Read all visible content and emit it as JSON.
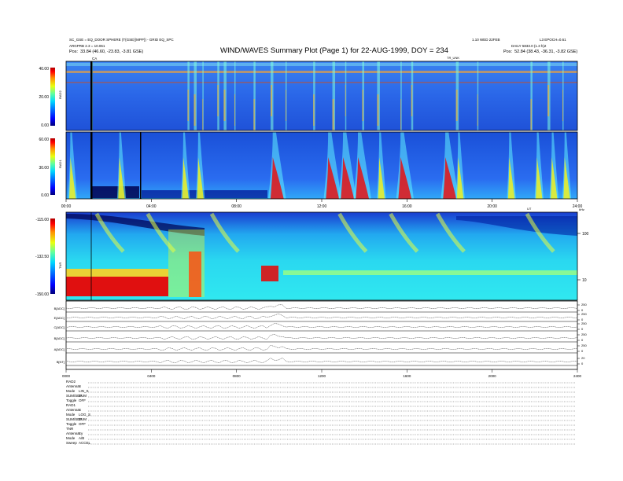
{
  "header": {
    "title": "WIND/WAVES Summary Plot (Page 1) for 22-AUG-1999, DOY = 234",
    "left_line1": "SC_GSE = EQ_DOOR SPHERE (T{GSE}{MPP}) - GRID EQ_SPC",
    "left_line2": "ARGPRB 2.3 = 10.061",
    "left_pos_label": "Pos:",
    "left_pos_value": "33.84 (46.60, -23.83, -3.81 GSE)",
    "right_line1": "1.10 WED 22FEB",
    "right_line1b": "L3 EPOCH=0.61",
    "right_line2": "DAILY 5833.0 (1.3 h)2",
    "right_pos_label": "Pos:",
    "right_pos_value": "52.84 (38.43, -36.31, -3.82 GSE)",
    "ca_marker": "CA",
    "tr_label": "TR_UNK"
  },
  "colors": {
    "colorbar": [
      "#00007a",
      "#0000ff",
      "#0070ff",
      "#00d8ff",
      "#60ffa0",
      "#e8ff10",
      "#ff9000",
      "#ff0000",
      "#b00000"
    ],
    "background_blue": "#2a66e8",
    "burst_red": "#e01010",
    "axis": "#000000"
  },
  "chart_data": [
    {
      "type": "heatmap",
      "name": "RAD2",
      "ylabel": "RAD2",
      "colorbar_ticks": [
        "40.00",
        "20.00",
        "0.00"
      ],
      "zlim": [
        0,
        40
      ],
      "xlim_hours": [
        0,
        24
      ],
      "bursts_hours": [
        1.2,
        5.7,
        6.0,
        6.4,
        7.1,
        7.4,
        7.9,
        8.8,
        9.6,
        10.3,
        11.6,
        12.5,
        13.1,
        13.9,
        14.6,
        15.7,
        16.2,
        18.3,
        19.3,
        21.8,
        22.6,
        23.3
      ]
    },
    {
      "type": "heatmap",
      "name": "RAD1",
      "ylabel": "RAD1",
      "colorbar_ticks": [
        "60.00",
        "30.00",
        "0.00"
      ],
      "zlim": [
        0,
        60
      ],
      "xlim_hours": [
        0,
        24
      ],
      "x_ticks": [
        "00:00",
        "04:00",
        "08:00",
        "12:00",
        "16:00",
        "20:00",
        "24:00"
      ],
      "x_axis_unit": "UT",
      "bursts_hours": [
        0.2,
        2.5,
        5.5,
        6.2,
        9.7,
        12.3,
        13.0,
        13.7,
        14.7,
        15.7,
        17.8,
        18.4,
        20.8,
        22.1,
        22.8,
        23.4
      ]
    },
    {
      "type": "heatmap",
      "name": "TNR",
      "ylabel": "TNR",
      "colorbar_ticks": [
        "-115.00",
        "-132.50",
        "-150.00"
      ],
      "zlim": [
        -150,
        -115
      ],
      "right_axis_ticks": [
        "100",
        "10"
      ],
      "right_axis_unit": "kHz",
      "xlim_hours": [
        0,
        24
      ]
    },
    {
      "type": "line",
      "name": "housekeeping",
      "series": [
        {
          "name": "B[ADC]"
        },
        {
          "name": "E[ADC]"
        },
        {
          "name": "C[ADC]"
        },
        {
          "name": "B[ADC]"
        },
        {
          "name": "A[ADC]"
        },
        {
          "name": "B[NT]"
        }
      ],
      "right_ticks": [
        "250",
        "0",
        "250",
        "0",
        "250",
        "0",
        "250",
        "0",
        "250",
        "0",
        "20",
        "0"
      ],
      "x_ticks": [
        "0000",
        "0400",
        "0800",
        "1200",
        "1600",
        "2000",
        "2400"
      ],
      "xlim_hours": [
        0,
        24
      ]
    }
  ],
  "status_table": {
    "rows": [
      {
        "key": "RAD2",
        "value": ""
      },
      {
        "key": "Antenna",
        "value": "S"
      },
      {
        "key": "Mode",
        "value": "LIN_S"
      },
      {
        "key": "SUM/SEP",
        "value": "SUM"
      },
      {
        "key": "Toggle",
        "value": "OFF"
      },
      {
        "key": "RAD1",
        "value": ""
      },
      {
        "key": "Antenna",
        "value": "S"
      },
      {
        "key": "Mode",
        "value": "LOG_S"
      },
      {
        "key": "SUM/SEP",
        "value": "SUM"
      },
      {
        "key": "Toggle",
        "value": "OFF"
      },
      {
        "key": "TNR",
        "value": ""
      },
      {
        "key": "Antenna",
        "value": "Ey"
      },
      {
        "key": "Mode",
        "value": "A/B"
      },
      {
        "key": "Sweep",
        "value": "ACCEL"
      }
    ]
  }
}
